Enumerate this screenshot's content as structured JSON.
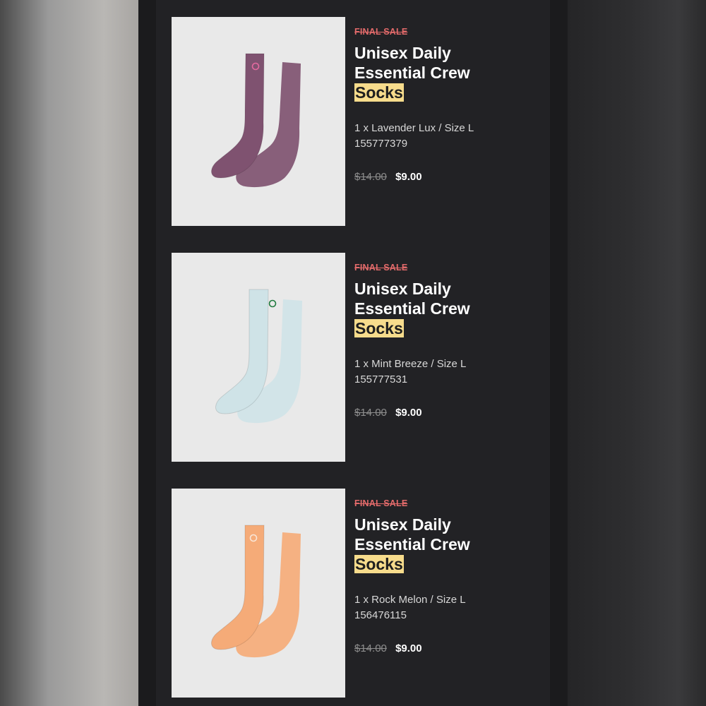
{
  "order_items": [
    {
      "badge": "FINAL SALE",
      "title_prefix": "Unisex Daily Essential Crew",
      "title_highlight": "Socks",
      "variant": "1 x Lavender Lux / Size L",
      "sku": "155777379",
      "original_price": "$14.00",
      "sale_price": "$9.00",
      "sock_color": "#7f5270",
      "logo_color": "#e56aa0"
    },
    {
      "badge": "FINAL SALE",
      "title_prefix": "Unisex Daily Essential Crew",
      "title_highlight": "Socks",
      "variant": "1 x Mint Breeze / Size L",
      "sku": "155777531",
      "original_price": "$14.00",
      "sale_price": "$9.00",
      "sock_color": "#cfe3e7",
      "logo_color": "#1f7a3e"
    },
    {
      "badge": "FINAL SALE",
      "title_prefix": "Unisex Daily Essential Crew",
      "title_highlight": "Socks",
      "variant": "1 x Rock Melon / Size L",
      "sku": "156476115",
      "original_price": "$14.00",
      "sale_price": "$9.00",
      "sock_color": "#f5ab78",
      "logo_color": "#f8e6d8"
    }
  ],
  "colors": {
    "badge_red": "#e26a6a",
    "highlight_yellow": "#f7dc8c",
    "panel_dark": "#222225"
  }
}
